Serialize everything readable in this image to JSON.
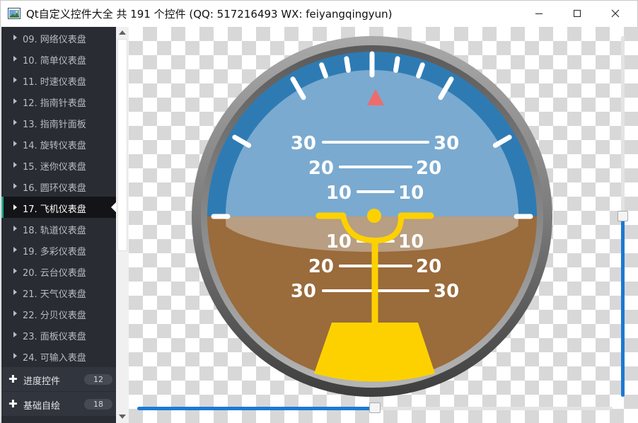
{
  "window": {
    "title": "Qt自定义控件大全 共 191 个控件 (QQ: 517216493 WX: feiyangqingyun)"
  },
  "sidebar": {
    "items": [
      {
        "label": "09. 网络仪表盘",
        "active": false
      },
      {
        "label": "10. 简单仪表盘",
        "active": false
      },
      {
        "label": "11. 时速仪表盘",
        "active": false
      },
      {
        "label": "12. 指南针表盘",
        "active": false
      },
      {
        "label": "13. 指南针面板",
        "active": false
      },
      {
        "label": "14. 旋转仪表盘",
        "active": false
      },
      {
        "label": "15. 迷你仪表盘",
        "active": false
      },
      {
        "label": "16. 圆环仪表盘",
        "active": false
      },
      {
        "label": "17. 飞机仪表盘",
        "active": true
      },
      {
        "label": "18. 轨道仪表盘",
        "active": false
      },
      {
        "label": "19. 多彩仪表盘",
        "active": false
      },
      {
        "label": "20. 云台仪表盘",
        "active": false
      },
      {
        "label": "21. 天气仪表盘",
        "active": false
      },
      {
        "label": "22. 分贝仪表盘",
        "active": false
      },
      {
        "label": "23. 面板仪表盘",
        "active": false
      },
      {
        "label": "24. 可输入表盘",
        "active": false
      }
    ],
    "groups": [
      {
        "label": "进度控件",
        "count": "12"
      },
      {
        "label": "基础自绘",
        "count": "18"
      }
    ]
  },
  "gauge": {
    "pitch_labels_upper": [
      "30",
      "20",
      "10"
    ],
    "pitch_labels_lower": [
      "10",
      "20",
      "30"
    ],
    "colors": {
      "sky": "#7aaad0",
      "sky_band": "#2e7bb4",
      "ground": "#9a6b3b",
      "horizon_light": "#b89e82",
      "aircraft": "#fdd100",
      "marker": "#f06b6b",
      "ticks": "#ffffff"
    }
  },
  "sliders": {
    "vertical_value": 0.5,
    "horizontal_value": 0.5,
    "accent": "#1c79d4"
  }
}
